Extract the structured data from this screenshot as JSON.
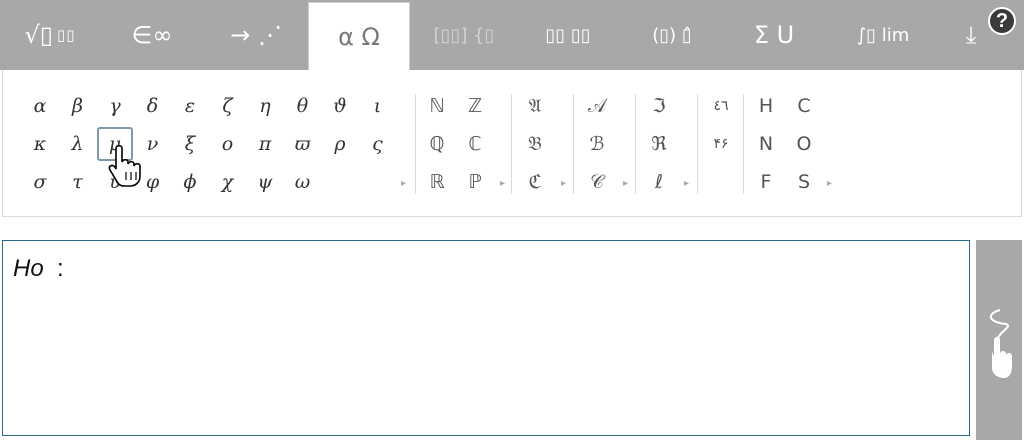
{
  "tabs": [
    {
      "id": "radical",
      "label": "√▯ ▯▯"
    },
    {
      "id": "elements",
      "label": "∈∞"
    },
    {
      "id": "arrows",
      "label": "→ ⋰"
    },
    {
      "id": "greek",
      "label": "α Ω"
    },
    {
      "id": "matrix",
      "label": "[▯▯] {▯"
    },
    {
      "id": "scripts",
      "label": "▯▯ ▯▯"
    },
    {
      "id": "brackets",
      "label": "(▯) ▯̂"
    },
    {
      "id": "operators",
      "label": "Σ U"
    },
    {
      "id": "calculus",
      "label": "∫▯ lim"
    },
    {
      "id": "handwrite",
      "label": "⤓"
    }
  ],
  "help_label": "?",
  "greek_rows": [
    [
      "α",
      "β",
      "γ",
      "δ",
      "ε",
      "ζ",
      "η",
      "θ",
      "ϑ",
      "ι"
    ],
    [
      "κ",
      "λ",
      "μ",
      "ν",
      "ξ",
      "ο",
      "π",
      "ϖ",
      "ρ",
      "ς"
    ],
    [
      "σ",
      "τ",
      "υ",
      "φ",
      "ϕ",
      "χ",
      "ψ",
      "ω"
    ]
  ],
  "blackboard": [
    [
      "ℕ",
      "ℤ"
    ],
    [
      "ℚ",
      "ℂ"
    ],
    [
      "ℝ",
      "ℙ"
    ]
  ],
  "fraktur": [
    "𝔄",
    "𝔅",
    "ℭ"
  ],
  "script": [
    "𝒜",
    "ℬ",
    "𝒞"
  ],
  "fraktur2": [
    "ℑ",
    "ℜ",
    "ℓ"
  ],
  "arabic": [
    "٤٦",
    "۴۶"
  ],
  "letters": [
    [
      "H",
      "C"
    ],
    [
      "N",
      "O"
    ],
    [
      "F",
      "S"
    ]
  ],
  "more_glyph": "▸",
  "editor": {
    "italic_text": "Ho",
    "colon": ":"
  }
}
